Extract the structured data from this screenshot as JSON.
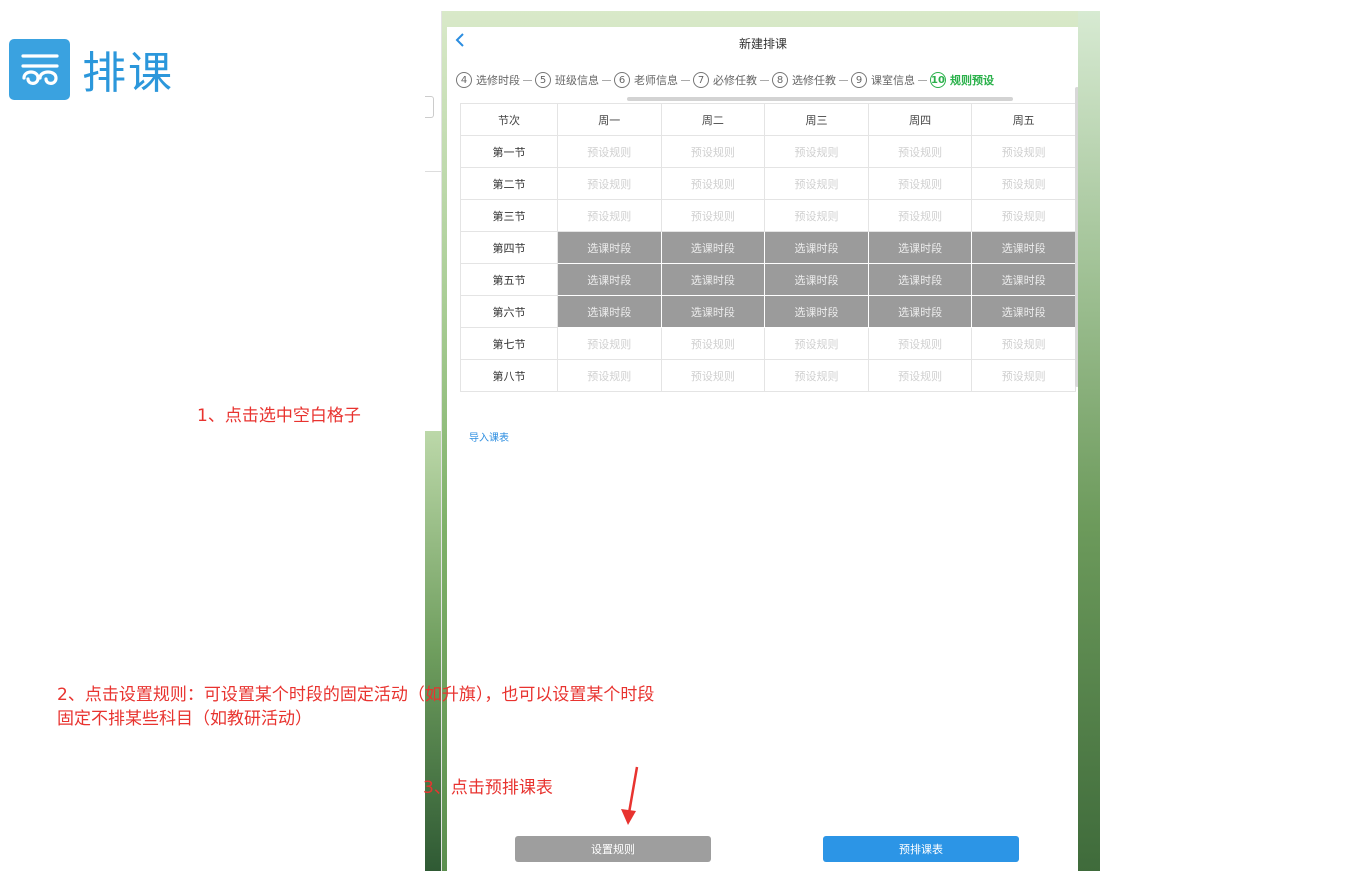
{
  "brand": {
    "title": "排课"
  },
  "app": {
    "title": "新建排课",
    "steps": [
      {
        "num": "4",
        "label": "选修时段"
      },
      {
        "num": "5",
        "label": "班级信息"
      },
      {
        "num": "6",
        "label": "老师信息"
      },
      {
        "num": "7",
        "label": "必修任教"
      },
      {
        "num": "8",
        "label": "选修任教"
      },
      {
        "num": "9",
        "label": "课室信息"
      },
      {
        "num": "10",
        "label": "规则预设"
      }
    ],
    "table": {
      "headers": [
        "节次",
        "周一",
        "周二",
        "周三",
        "周四",
        "周五"
      ],
      "rows": [
        {
          "period": "第一节",
          "cell": "预设规则"
        },
        {
          "period": "第二节",
          "cell": "预设规则"
        },
        {
          "period": "第三节",
          "cell": "预设规则"
        },
        {
          "period": "第四节",
          "cell": "选课时段"
        },
        {
          "period": "第五节",
          "cell": "选课时段"
        },
        {
          "period": "第六节",
          "cell": "选课时段"
        },
        {
          "period": "第七节",
          "cell": "预设规则"
        },
        {
          "period": "第八节",
          "cell": "预设规则"
        }
      ]
    },
    "import_link": "导入课表",
    "buttons": {
      "set_rule": "设置规则",
      "pre_schedule": "预排课表"
    }
  },
  "annotations": {
    "a1": "1、点击选中空白格子",
    "a2": "2、点击设置规则：可设置某个时段的固定活动（如升旗），也可以设置某个时段固定不排某些科目（如教研活动）",
    "a3": "3、点击预排课表"
  },
  "colors": {
    "accent": "#2c95e6",
    "active_step": "#2bb14b",
    "annotation": "#e8332f",
    "selected_cell": "#9b9b9b"
  }
}
